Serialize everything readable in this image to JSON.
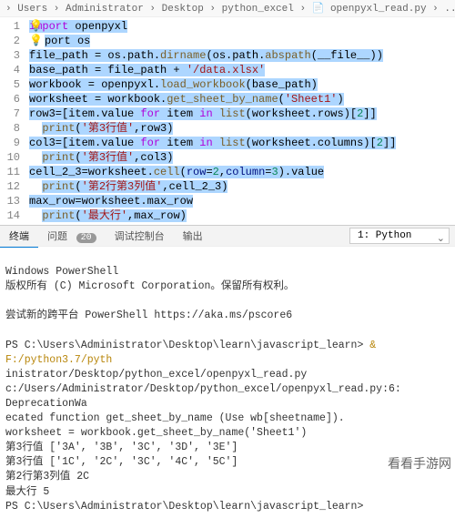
{
  "breadcrumb": "  › Users › Administrator › Desktop › python_excel › 📄 openpyxl_read.py › ...",
  "code_lines": [
    {
      "n": 1,
      "html": "<span class='lint'>💡</span><span class='sel'><span class='kw'>import</span> openpyxl</span>"
    },
    {
      "n": 2,
      "html": "<span class='bulb'>💡</span><span class='sel'>port os</span>"
    },
    {
      "n": 3,
      "html": "<span class='sel'>file_path = os.path.<span class='fn'>dirname</span>(os.path.<span class='fn'>abspath</span>(__file__))</span>"
    },
    {
      "n": 4,
      "html": "<span class='sel'>base_path = file_path + <span class='str'>'/data.xlsx'</span></span>"
    },
    {
      "n": 5,
      "html": "<span class='sel'>workbook = openpyxl.<span class='fn'>load_workbook</span>(base_path)</span>"
    },
    {
      "n": 6,
      "html": "<span class='sel'>worksheet = workbook.<span class='fn'>get_sheet_by_name</span>(<span class='str'>'Sheet1'</span>)</span>"
    },
    {
      "n": 7,
      "html": "<span class='sel'>row3=[item.value <span class='kw'>for</span> item <span class='kw'>in</span> <span class='fn'>list</span>(worksheet.rows)[<span class='num'>2</span>]]</span>"
    },
    {
      "n": 8,
      "html": "  <span class='sel'><span class='fn'>print</span>(<span class='str'>'第3行值'</span>,row3)</span>"
    },
    {
      "n": 9,
      "html": "<span class='sel'>col3=[item.value <span class='kw'>for</span> item <span class='kw'>in</span> <span class='fn'>list</span>(worksheet.columns)[<span class='num'>2</span>]]</span>"
    },
    {
      "n": 10,
      "html": "  <span class='sel'><span class='fn'>print</span>(<span class='str'>'第3行值'</span>,col3)</span>"
    },
    {
      "n": 11,
      "html": "<span class='sel'>cell_2_3=worksheet.<span class='fn'>cell</span>(<span class='var'>row</span>=<span class='num'>2</span>,<span class='var'>column</span>=<span class='num'>3</span>).value</span>"
    },
    {
      "n": 12,
      "html": "  <span class='sel'><span class='fn'>print</span>(<span class='str'>'第2行第3列值'</span>,cell_2_3)</span>"
    },
    {
      "n": 13,
      "html": "<span class='sel'>max_row=worksheet.max_row</span>"
    },
    {
      "n": 14,
      "html": "  <span class='sel'><span class='fn'>print</span>(<span class='str'>'最大行'</span>,max_row)</span>"
    }
  ],
  "tabs": {
    "terminal": "终端",
    "problems": "问题",
    "problems_count": "20",
    "debug": "调试控制台",
    "output": "输出"
  },
  "dropdown": {
    "selected": "1: Python"
  },
  "terminal_lines": [
    "",
    "Windows PowerShell",
    "版权所有 (C) Microsoft Corporation。保留所有权利。",
    "",
    "尝试新的跨平台 PowerShell https://aka.ms/pscore6",
    "",
    {
      "prompt": "PS C:\\Users\\Administrator\\Desktop\\learn\\javascript_learn>",
      "cmd": " & F:/python3.7/pyth"
    },
    "inistrator/Desktop/python_excel/openpyxl_read.py",
    "c:/Users/Administrator/Desktop/python_excel/openpyxl_read.py:6: DeprecationWa",
    "ecated function get_sheet_by_name (Use wb[sheetname]).",
    "  worksheet = workbook.get_sheet_by_name('Sheet1')",
    "第3行值 ['3A', '3B', '3C', '3D', '3E']",
    "第3行值 ['1C', '2C', '3C', '4C', '5C']",
    "第2行第3列值 2C",
    "最大行 5",
    {
      "prompt": "PS C:\\Users\\Administrator\\Desktop\\learn\\javascript_learn>",
      "cmd": ""
    }
  ],
  "watermark": "看看手游网"
}
